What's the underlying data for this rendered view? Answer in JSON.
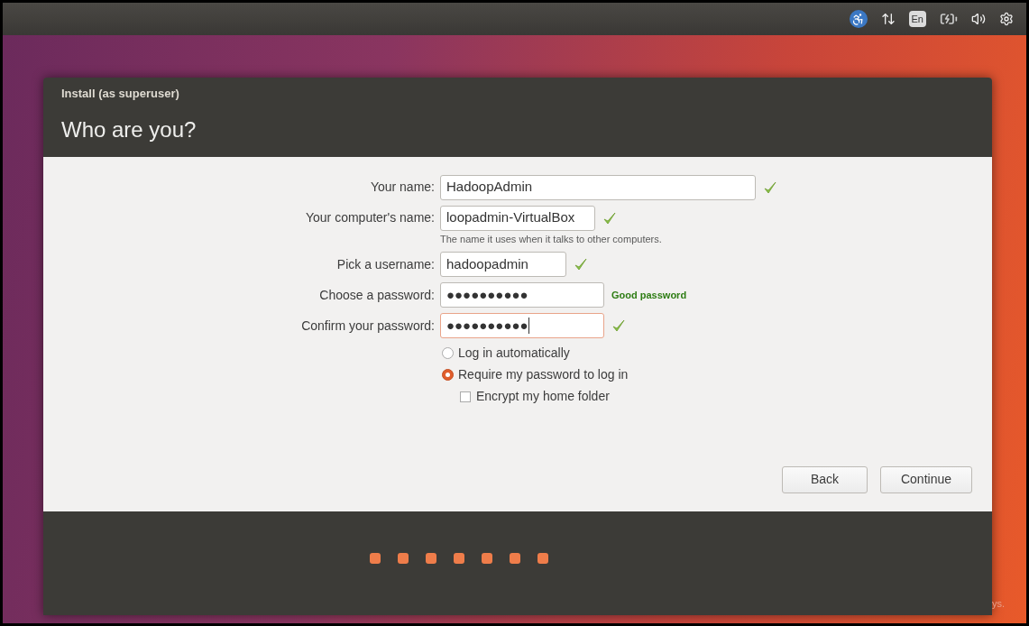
{
  "top_panel": {
    "keyboard_layout": "En"
  },
  "window": {
    "title": "Install (as superuser)",
    "heading": "Who are you?"
  },
  "fields": [
    {
      "label": "Your name:",
      "value": "HadoopAdmin",
      "valid": true,
      "focused": false
    },
    {
      "label": "Your computer's name:",
      "value": "loopadmin-VirtualBox",
      "valid": true,
      "focused": false,
      "hint": "The name it uses when it talks to other computers."
    },
    {
      "label": "Pick a username:",
      "value": "hadoopadmin",
      "valid": true,
      "focused": false
    },
    {
      "label": "Choose a password:",
      "value": "●●●●●●●●●●",
      "focused": false,
      "strength": "Good password"
    },
    {
      "label": "Confirm your password:",
      "value": "●●●●●●●●●●",
      "valid": true,
      "focused": true
    }
  ],
  "login_options": [
    {
      "kind": "radio",
      "label": "Log in automatically",
      "selected": false
    },
    {
      "kind": "radio",
      "label": "Require my password to log in",
      "selected": true
    },
    {
      "kind": "checkbox",
      "label": "Encrypt my home folder",
      "checked": false
    }
  ],
  "buttons": [
    "Back",
    "Continue"
  ],
  "progress_steps": [
    {
      "done": true
    },
    {
      "done": true
    },
    {
      "done": true
    },
    {
      "done": true
    },
    {
      "done": true
    },
    {
      "done": true
    },
    {
      "done": true
    }
  ],
  "desktop_text": "ys."
}
